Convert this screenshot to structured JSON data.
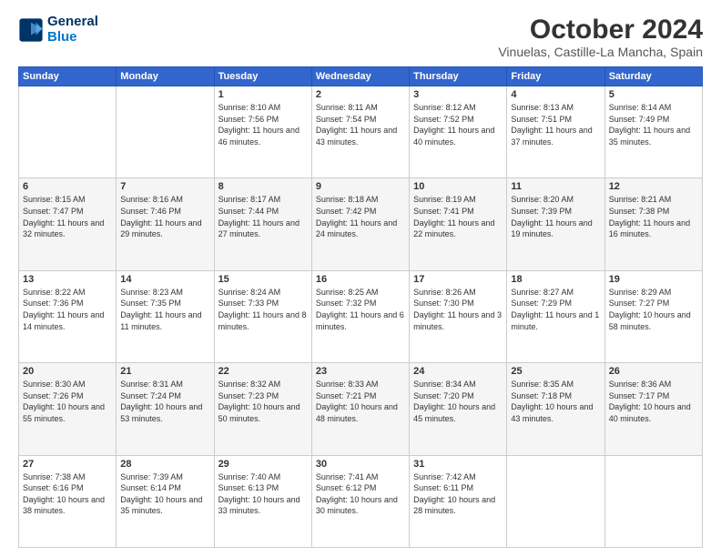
{
  "header": {
    "logo": {
      "line1": "General",
      "line2": "Blue"
    },
    "title": "October 2024",
    "location": "Vinuelas, Castille-La Mancha, Spain"
  },
  "weekdays": [
    "Sunday",
    "Monday",
    "Tuesday",
    "Wednesday",
    "Thursday",
    "Friday",
    "Saturday"
  ],
  "weeks": [
    [
      {
        "day": "",
        "info": ""
      },
      {
        "day": "",
        "info": ""
      },
      {
        "day": "1",
        "info": "Sunrise: 8:10 AM\nSunset: 7:56 PM\nDaylight: 11 hours and 46 minutes."
      },
      {
        "day": "2",
        "info": "Sunrise: 8:11 AM\nSunset: 7:54 PM\nDaylight: 11 hours and 43 minutes."
      },
      {
        "day": "3",
        "info": "Sunrise: 8:12 AM\nSunset: 7:52 PM\nDaylight: 11 hours and 40 minutes."
      },
      {
        "day": "4",
        "info": "Sunrise: 8:13 AM\nSunset: 7:51 PM\nDaylight: 11 hours and 37 minutes."
      },
      {
        "day": "5",
        "info": "Sunrise: 8:14 AM\nSunset: 7:49 PM\nDaylight: 11 hours and 35 minutes."
      }
    ],
    [
      {
        "day": "6",
        "info": "Sunrise: 8:15 AM\nSunset: 7:47 PM\nDaylight: 11 hours and 32 minutes."
      },
      {
        "day": "7",
        "info": "Sunrise: 8:16 AM\nSunset: 7:46 PM\nDaylight: 11 hours and 29 minutes."
      },
      {
        "day": "8",
        "info": "Sunrise: 8:17 AM\nSunset: 7:44 PM\nDaylight: 11 hours and 27 minutes."
      },
      {
        "day": "9",
        "info": "Sunrise: 8:18 AM\nSunset: 7:42 PM\nDaylight: 11 hours and 24 minutes."
      },
      {
        "day": "10",
        "info": "Sunrise: 8:19 AM\nSunset: 7:41 PM\nDaylight: 11 hours and 22 minutes."
      },
      {
        "day": "11",
        "info": "Sunrise: 8:20 AM\nSunset: 7:39 PM\nDaylight: 11 hours and 19 minutes."
      },
      {
        "day": "12",
        "info": "Sunrise: 8:21 AM\nSunset: 7:38 PM\nDaylight: 11 hours and 16 minutes."
      }
    ],
    [
      {
        "day": "13",
        "info": "Sunrise: 8:22 AM\nSunset: 7:36 PM\nDaylight: 11 hours and 14 minutes."
      },
      {
        "day": "14",
        "info": "Sunrise: 8:23 AM\nSunset: 7:35 PM\nDaylight: 11 hours and 11 minutes."
      },
      {
        "day": "15",
        "info": "Sunrise: 8:24 AM\nSunset: 7:33 PM\nDaylight: 11 hours and 8 minutes."
      },
      {
        "day": "16",
        "info": "Sunrise: 8:25 AM\nSunset: 7:32 PM\nDaylight: 11 hours and 6 minutes."
      },
      {
        "day": "17",
        "info": "Sunrise: 8:26 AM\nSunset: 7:30 PM\nDaylight: 11 hours and 3 minutes."
      },
      {
        "day": "18",
        "info": "Sunrise: 8:27 AM\nSunset: 7:29 PM\nDaylight: 11 hours and 1 minute."
      },
      {
        "day": "19",
        "info": "Sunrise: 8:29 AM\nSunset: 7:27 PM\nDaylight: 10 hours and 58 minutes."
      }
    ],
    [
      {
        "day": "20",
        "info": "Sunrise: 8:30 AM\nSunset: 7:26 PM\nDaylight: 10 hours and 55 minutes."
      },
      {
        "day": "21",
        "info": "Sunrise: 8:31 AM\nSunset: 7:24 PM\nDaylight: 10 hours and 53 minutes."
      },
      {
        "day": "22",
        "info": "Sunrise: 8:32 AM\nSunset: 7:23 PM\nDaylight: 10 hours and 50 minutes."
      },
      {
        "day": "23",
        "info": "Sunrise: 8:33 AM\nSunset: 7:21 PM\nDaylight: 10 hours and 48 minutes."
      },
      {
        "day": "24",
        "info": "Sunrise: 8:34 AM\nSunset: 7:20 PM\nDaylight: 10 hours and 45 minutes."
      },
      {
        "day": "25",
        "info": "Sunrise: 8:35 AM\nSunset: 7:18 PM\nDaylight: 10 hours and 43 minutes."
      },
      {
        "day": "26",
        "info": "Sunrise: 8:36 AM\nSunset: 7:17 PM\nDaylight: 10 hours and 40 minutes."
      }
    ],
    [
      {
        "day": "27",
        "info": "Sunrise: 7:38 AM\nSunset: 6:16 PM\nDaylight: 10 hours and 38 minutes."
      },
      {
        "day": "28",
        "info": "Sunrise: 7:39 AM\nSunset: 6:14 PM\nDaylight: 10 hours and 35 minutes."
      },
      {
        "day": "29",
        "info": "Sunrise: 7:40 AM\nSunset: 6:13 PM\nDaylight: 10 hours and 33 minutes."
      },
      {
        "day": "30",
        "info": "Sunrise: 7:41 AM\nSunset: 6:12 PM\nDaylight: 10 hours and 30 minutes."
      },
      {
        "day": "31",
        "info": "Sunrise: 7:42 AM\nSunset: 6:11 PM\nDaylight: 10 hours and 28 minutes."
      },
      {
        "day": "",
        "info": ""
      },
      {
        "day": "",
        "info": ""
      }
    ]
  ]
}
